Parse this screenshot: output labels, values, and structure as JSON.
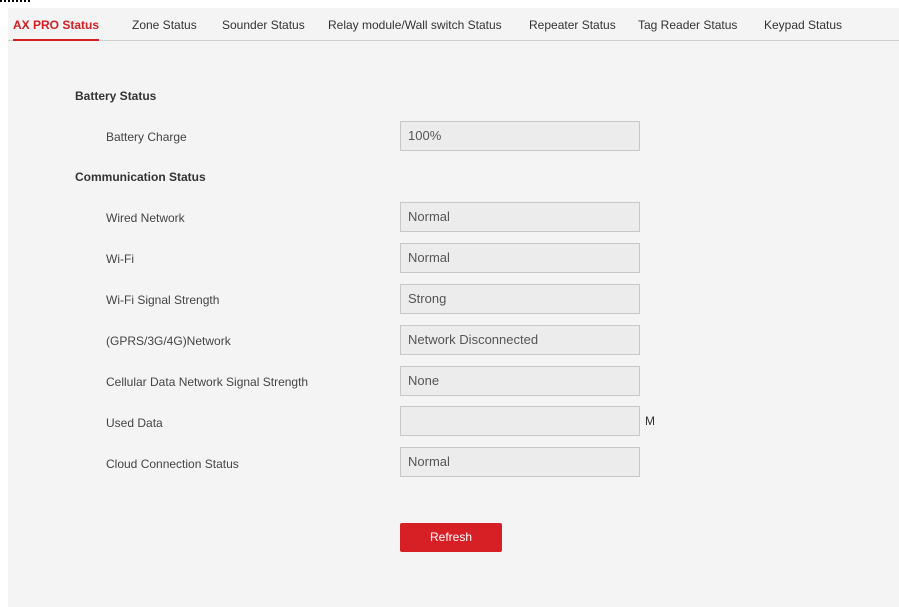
{
  "tabs": [
    {
      "label": "AX PRO Status"
    },
    {
      "label": "Zone Status"
    },
    {
      "label": "Sounder Status"
    },
    {
      "label": "Relay module/Wall switch Status"
    },
    {
      "label": "Repeater Status"
    },
    {
      "label": "Tag Reader Status"
    },
    {
      "label": "Keypad Status"
    }
  ],
  "battery": {
    "title": "Battery Status",
    "rows": [
      {
        "label": "Battery Charge",
        "value": "100%"
      }
    ]
  },
  "communication": {
    "title": "Communication Status",
    "rows": [
      {
        "label": "Wired Network",
        "value": "Normal"
      },
      {
        "label": "Wi-Fi",
        "value": "Normal"
      },
      {
        "label": "Wi-Fi Signal Strength",
        "value": "Strong"
      },
      {
        "label": "(GPRS/3G/4G)Network",
        "value": "Network Disconnected"
      },
      {
        "label": "Cellular Data Network Signal Strength",
        "value": "None"
      },
      {
        "label": "Used Data",
        "value": "",
        "unit": "M"
      },
      {
        "label": "Cloud Connection Status",
        "value": "Normal"
      }
    ]
  },
  "actions": {
    "refresh_label": "Refresh"
  },
  "colors": {
    "accent": "#d41e24",
    "background": "#f4f4f4"
  }
}
